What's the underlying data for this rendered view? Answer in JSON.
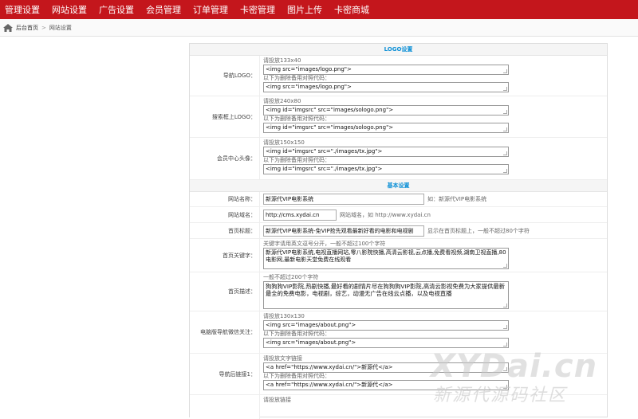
{
  "nav": {
    "items": [
      "管理设置",
      "网站设置",
      "广告设置",
      "会员管理",
      "订单管理",
      "卡密管理",
      "图片上传",
      "卡密商城"
    ]
  },
  "breadcrumb": {
    "home": "后台首页",
    "current": "网站设置"
  },
  "sections": {
    "logo": "LOGO设置",
    "basic": "基本设置"
  },
  "logo_rows": {
    "nav_logo": {
      "label": "导航LOGO：",
      "hint1": "请投放133x40",
      "code1": "<img src=\"images/logo.png\">",
      "hint2": "以下为删除备用对照代码：",
      "code2": "<img src=\"images/logo.png\">"
    },
    "search_logo": {
      "label": "搜索框上LOGO：",
      "hint1": "请投放240x80",
      "code1": "<img id=\"imgsrc\" src=\"images/sologo.png\">",
      "hint2": "以下为删除备用对照代码：",
      "code2": "<img id=\"imgsrc\" src=\"images/sologo.png\">"
    },
    "member_avatar": {
      "label": "会员中心头像：",
      "hint1": "请投放150x150",
      "code1": "<img id=\"imgsrc\" src=\"./images/tx.jpg\">",
      "hint2": "以下为删除备用对照代码：",
      "code2": "<img id=\"imgsrc\" src=\"./images/tx.jpg\">"
    }
  },
  "basic": {
    "site_name": {
      "label": "网站名称：",
      "value": "新源代VIP电影系统",
      "note": "如：新源代VIP电影系统"
    },
    "site_domain": {
      "label": "网站域名：",
      "value": "http://cms.xydai.cn",
      "note": "网站域名，如 http://www.xydai.cn"
    },
    "home_title": {
      "label": "首页标题：",
      "value": "新源代VIP电影系统-免VIP抢先观看最新好看的电影和电视剧",
      "note": "显示在首页标题上，一般不超过80个字符"
    },
    "home_keywords": {
      "label": "首页关键字：",
      "hint": "关键字请用英文逗号分开，一般不超过100个字符",
      "value": "新源代VIP电影系统,电视直播网站,零八影院快播,高清云影视,云点播,免费看视频,湖南卫视直播,80电影网,最新电影天堂免费在线观看"
    },
    "home_desc": {
      "label": "首页描述：",
      "hint": "一般不超过200个字符",
      "value": "狗狗狗VIP影院,热剧快播,最好看的剧情片尽在狗狗狗VIP影院,高清云影视免费为大家提供最新最全的免费电影，电视剧，综艺，动漫无广告在线云点播，以及电视直播"
    },
    "wechat": {
      "label": "电脑版导航微信关注：",
      "hint1": "请投放130x130",
      "code1": "<img src=\"images/about.png\">",
      "hint2": "以下为删除备用对照代码：",
      "code2": "<img src=\"images/about.png\">"
    },
    "nav_link1": {
      "label": "导航后链接1：",
      "hint1": "请投放文字链接",
      "code1": "<a href=\"https://www.xydai.cn/\">新源代</a>",
      "hint2": "以下为删除备用对照代码：",
      "code2": "<a href=\"https://www.xydai.cn/\">新源代</a>"
    },
    "nav_link2": {
      "hint1": "请投放链接"
    }
  },
  "watermark": {
    "line1": "XYDai.cn",
    "line2": "新源代源码社区"
  }
}
